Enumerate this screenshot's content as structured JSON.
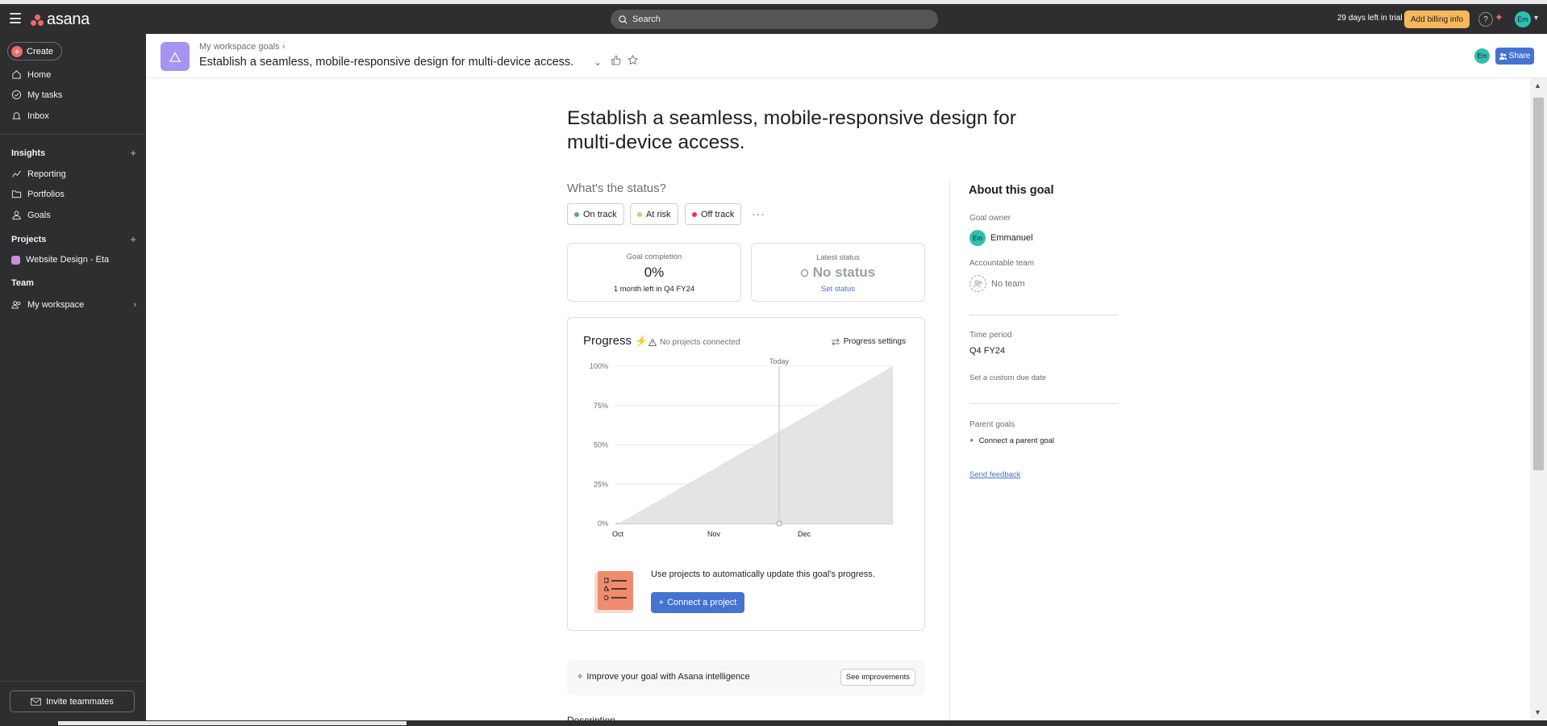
{
  "topbar": {
    "app_name": "asana",
    "search_placeholder": "Search",
    "trial_text": "29 days left in trial",
    "billing_button": "Add billing info",
    "help_label": "?",
    "user_initials": "Em"
  },
  "sidebar": {
    "create_label": "Create",
    "nav": [
      {
        "label": "Home",
        "icon": "home-icon"
      },
      {
        "label": "My tasks",
        "icon": "check-circle-icon"
      },
      {
        "label": "Inbox",
        "icon": "bell-icon"
      }
    ],
    "insights": {
      "title": "Insights",
      "items": [
        {
          "label": "Reporting",
          "icon": "reporting-icon"
        },
        {
          "label": "Portfolios",
          "icon": "folder-icon"
        },
        {
          "label": "Goals",
          "icon": "person-icon"
        }
      ]
    },
    "projects": {
      "title": "Projects",
      "items": [
        {
          "label": "Website Design - Eta",
          "color": "#c98ee0"
        }
      ]
    },
    "team": {
      "title": "Team",
      "items": [
        {
          "label": "My workspace",
          "icon": "team-icon"
        }
      ]
    },
    "invite_label": "Invite teammates"
  },
  "header": {
    "breadcrumb": "My workspace goals",
    "title": "Establish a seamless, mobile-responsive design for multi-device access.",
    "avatar_initials": "Em",
    "share_label": "Share"
  },
  "main": {
    "title": "Establish a seamless, mobile-responsive design for multi-device access.",
    "status_question": "What's the status?",
    "status_options": [
      {
        "label": "On track",
        "color": "#5da283"
      },
      {
        "label": "At risk",
        "color": "#f1bd6c"
      },
      {
        "label": "Off track",
        "color": "#e8384f"
      }
    ],
    "completion": {
      "label": "Goal completion",
      "value": "0%",
      "sub": "1 month left in Q4 FY24"
    },
    "latest_status": {
      "label": "Latest status",
      "value": "No status",
      "link": "Set status"
    },
    "progress": {
      "title": "Progress",
      "warning": "No projects connected",
      "settings": "Progress settings",
      "today_label": "Today",
      "connect_text": "Use projects to automatically update this goal's progress.",
      "connect_button": "Connect a project"
    },
    "improve": {
      "text": "Improve your goal with Asana intelligence",
      "button": "See improvements"
    },
    "description_label": "Description"
  },
  "chart_data": {
    "type": "area",
    "x": [
      "Oct",
      "Nov",
      "Dec"
    ],
    "yticks": [
      "100%",
      "75%",
      "50%",
      "25%",
      "0%"
    ],
    "ylim": [
      0,
      100
    ],
    "series": [
      {
        "points": [
          [
            "Oct 1",
            0
          ],
          [
            "Dec 31",
            100
          ]
        ]
      }
    ],
    "today_marker": "Today",
    "grid": true
  },
  "about": {
    "title": "About this goal",
    "owner_label": "Goal owner",
    "owner_initials": "Em",
    "owner_name": "Emmanuel",
    "team_label": "Accountable team",
    "team_value": "No team",
    "period_label": "Time period",
    "period_value": "Q4 FY24",
    "custom_due": "Set a custom due date",
    "parent_label": "Parent goals",
    "parent_link": "Connect a parent goal",
    "feedback": "Send feedback"
  }
}
